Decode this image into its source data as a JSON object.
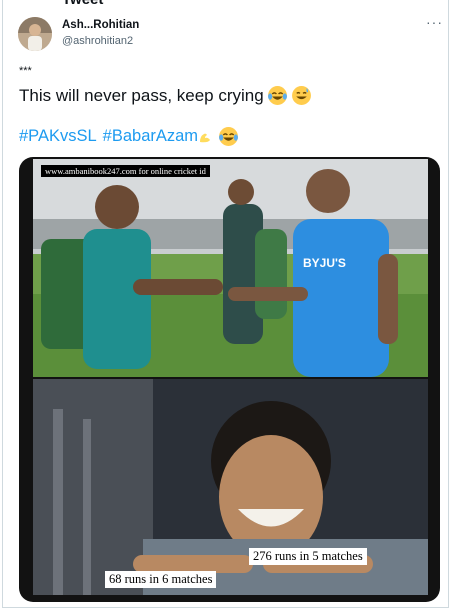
{
  "header": {
    "title": "Tweet"
  },
  "tweet": {
    "author_name": "Ash...Rohitian",
    "author_handle": "@ashrohitian2",
    "more_icon": "more-dots-icon",
    "line1": "***",
    "line2": "This will never pass, keep crying",
    "hashtags": [
      "#PAKvsSL",
      "#BabarAzam"
    ],
    "emojis": [
      "face-with-tears-of-joy",
      "grinning-face-with-sweat",
      "flexed-biceps",
      "face-with-tears-of-joy"
    ]
  },
  "meme": {
    "watermark": "www.ambanibook247.com for online cricket id",
    "jersey_text": "BYJU'S",
    "caption_top": "276 runs in 5 matches",
    "caption_bottom": "68 runs in 6 matches"
  },
  "colors": {
    "link": "#1d9bf0",
    "secondary": "#536471",
    "border": "#cfd9de"
  }
}
